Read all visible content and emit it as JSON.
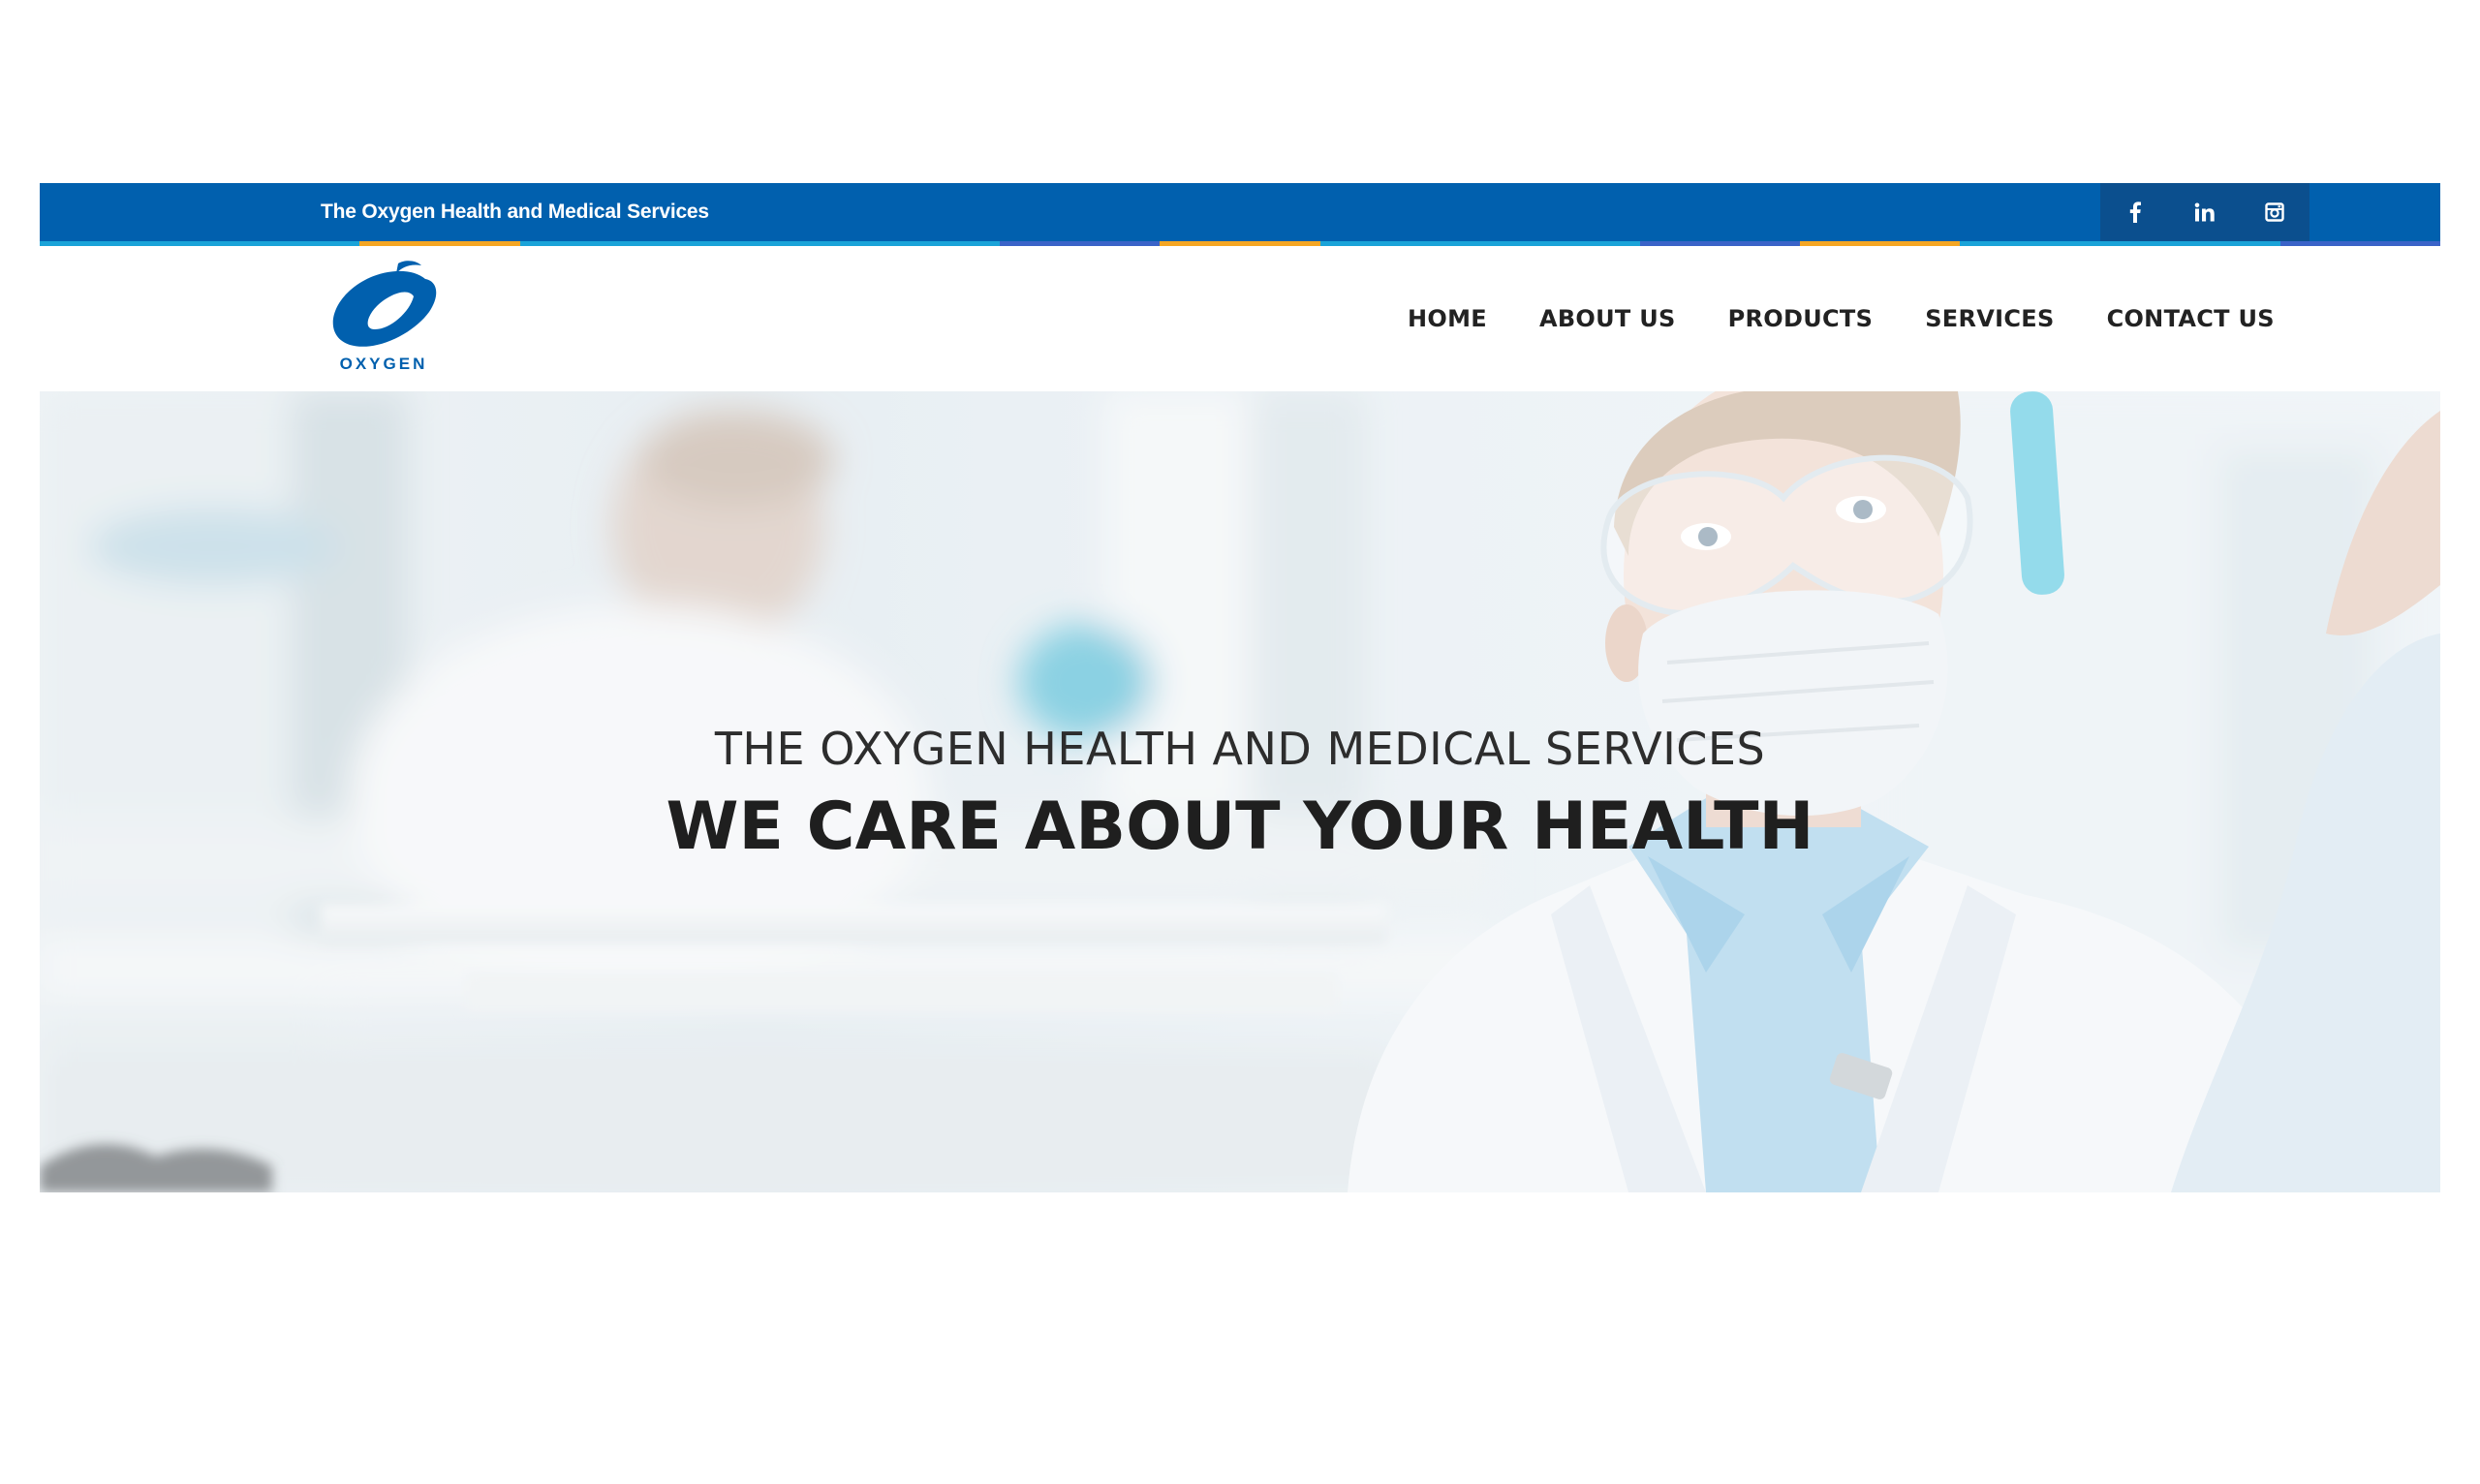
{
  "topbar": {
    "title": "The Oxygen Health and Medical Services",
    "social": [
      {
        "icon": "facebook-icon",
        "glyph": "f"
      },
      {
        "icon": "linkedin-icon",
        "glyph": "in"
      },
      {
        "icon": "instagram-icon",
        "glyph": ""
      }
    ],
    "stripe_colors": [
      "#1aa3d8",
      "#1aa3d8",
      "#f5a623",
      "#1aa3d8",
      "#1aa3d8",
      "#1aa3d8",
      "#3a63c8",
      "#f5a623",
      "#1aa3d8",
      "#1aa3d8",
      "#3a63c8",
      "#f5a623",
      "#1aa3d8",
      "#1aa3d8",
      "#3a63c8"
    ]
  },
  "header": {
    "logo_text": "OXYGEN",
    "nav": [
      "HOME",
      "ABOUT US",
      "PRODUCTS",
      "SERVICES",
      "CONTACT US"
    ]
  },
  "hero": {
    "subtitle": "THE OXYGEN HEALTH AND MEDICAL SERVICES",
    "title": "WE CARE ABOUT YOUR HEALTH"
  },
  "colors": {
    "brand_blue": "#0160ae",
    "social_bg": "#0b4f8e",
    "accent_orange": "#f5a623",
    "accent_cyan": "#1aa3d8"
  }
}
